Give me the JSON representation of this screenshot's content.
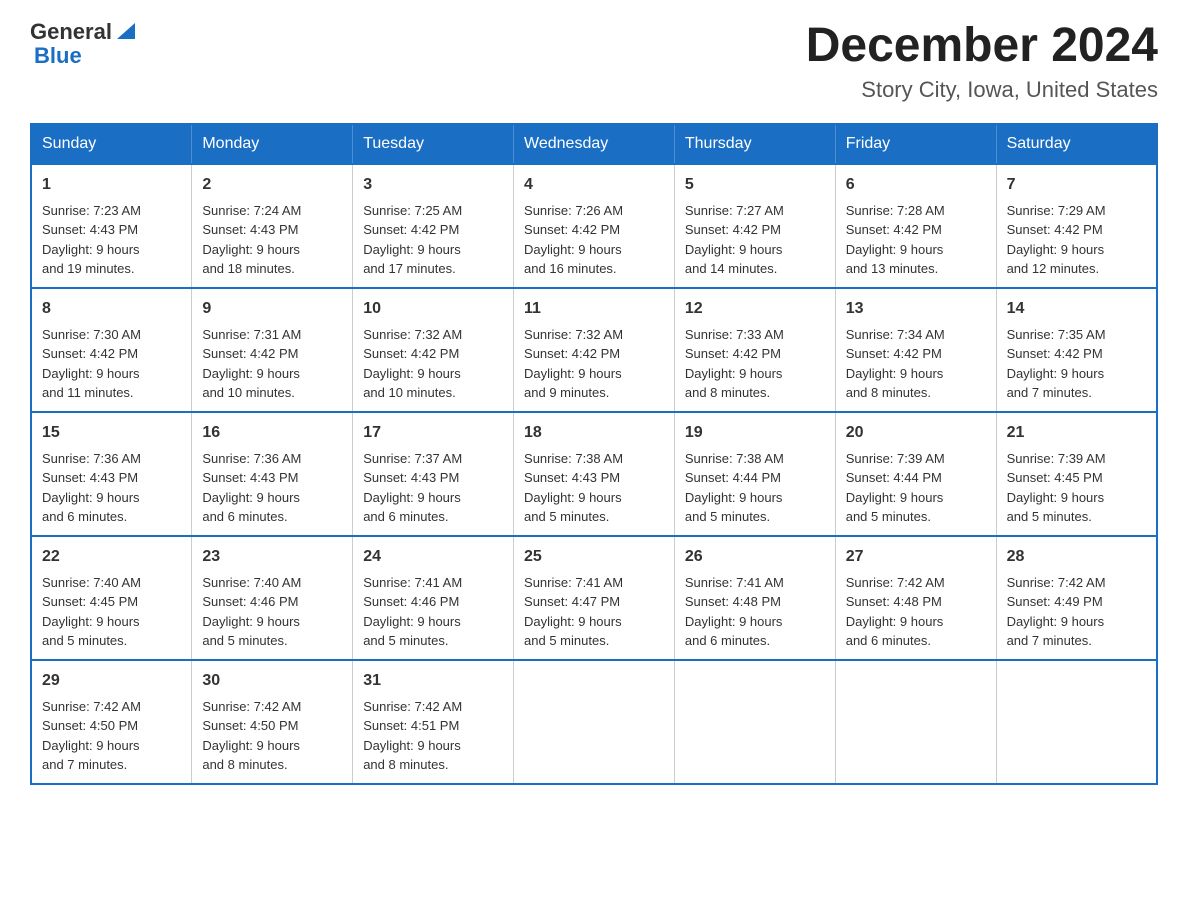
{
  "header": {
    "logo": {
      "general": "General",
      "blue": "Blue"
    },
    "title": "December 2024",
    "location": "Story City, Iowa, United States"
  },
  "days_of_week": [
    "Sunday",
    "Monday",
    "Tuesday",
    "Wednesday",
    "Thursday",
    "Friday",
    "Saturday"
  ],
  "weeks": [
    [
      {
        "day": "1",
        "sunrise": "7:23 AM",
        "sunset": "4:43 PM",
        "daylight": "9 hours and 19 minutes."
      },
      {
        "day": "2",
        "sunrise": "7:24 AM",
        "sunset": "4:43 PM",
        "daylight": "9 hours and 18 minutes."
      },
      {
        "day": "3",
        "sunrise": "7:25 AM",
        "sunset": "4:42 PM",
        "daylight": "9 hours and 17 minutes."
      },
      {
        "day": "4",
        "sunrise": "7:26 AM",
        "sunset": "4:42 PM",
        "daylight": "9 hours and 16 minutes."
      },
      {
        "day": "5",
        "sunrise": "7:27 AM",
        "sunset": "4:42 PM",
        "daylight": "9 hours and 14 minutes."
      },
      {
        "day": "6",
        "sunrise": "7:28 AM",
        "sunset": "4:42 PM",
        "daylight": "9 hours and 13 minutes."
      },
      {
        "day": "7",
        "sunrise": "7:29 AM",
        "sunset": "4:42 PM",
        "daylight": "9 hours and 12 minutes."
      }
    ],
    [
      {
        "day": "8",
        "sunrise": "7:30 AM",
        "sunset": "4:42 PM",
        "daylight": "9 hours and 11 minutes."
      },
      {
        "day": "9",
        "sunrise": "7:31 AM",
        "sunset": "4:42 PM",
        "daylight": "9 hours and 10 minutes."
      },
      {
        "day": "10",
        "sunrise": "7:32 AM",
        "sunset": "4:42 PM",
        "daylight": "9 hours and 10 minutes."
      },
      {
        "day": "11",
        "sunrise": "7:32 AM",
        "sunset": "4:42 PM",
        "daylight": "9 hours and 9 minutes."
      },
      {
        "day": "12",
        "sunrise": "7:33 AM",
        "sunset": "4:42 PM",
        "daylight": "9 hours and 8 minutes."
      },
      {
        "day": "13",
        "sunrise": "7:34 AM",
        "sunset": "4:42 PM",
        "daylight": "9 hours and 8 minutes."
      },
      {
        "day": "14",
        "sunrise": "7:35 AM",
        "sunset": "4:42 PM",
        "daylight": "9 hours and 7 minutes."
      }
    ],
    [
      {
        "day": "15",
        "sunrise": "7:36 AM",
        "sunset": "4:43 PM",
        "daylight": "9 hours and 6 minutes."
      },
      {
        "day": "16",
        "sunrise": "7:36 AM",
        "sunset": "4:43 PM",
        "daylight": "9 hours and 6 minutes."
      },
      {
        "day": "17",
        "sunrise": "7:37 AM",
        "sunset": "4:43 PM",
        "daylight": "9 hours and 6 minutes."
      },
      {
        "day": "18",
        "sunrise": "7:38 AM",
        "sunset": "4:43 PM",
        "daylight": "9 hours and 5 minutes."
      },
      {
        "day": "19",
        "sunrise": "7:38 AM",
        "sunset": "4:44 PM",
        "daylight": "9 hours and 5 minutes."
      },
      {
        "day": "20",
        "sunrise": "7:39 AM",
        "sunset": "4:44 PM",
        "daylight": "9 hours and 5 minutes."
      },
      {
        "day": "21",
        "sunrise": "7:39 AM",
        "sunset": "4:45 PM",
        "daylight": "9 hours and 5 minutes."
      }
    ],
    [
      {
        "day": "22",
        "sunrise": "7:40 AM",
        "sunset": "4:45 PM",
        "daylight": "9 hours and 5 minutes."
      },
      {
        "day": "23",
        "sunrise": "7:40 AM",
        "sunset": "4:46 PM",
        "daylight": "9 hours and 5 minutes."
      },
      {
        "day": "24",
        "sunrise": "7:41 AM",
        "sunset": "4:46 PM",
        "daylight": "9 hours and 5 minutes."
      },
      {
        "day": "25",
        "sunrise": "7:41 AM",
        "sunset": "4:47 PM",
        "daylight": "9 hours and 5 minutes."
      },
      {
        "day": "26",
        "sunrise": "7:41 AM",
        "sunset": "4:48 PM",
        "daylight": "9 hours and 6 minutes."
      },
      {
        "day": "27",
        "sunrise": "7:42 AM",
        "sunset": "4:48 PM",
        "daylight": "9 hours and 6 minutes."
      },
      {
        "day": "28",
        "sunrise": "7:42 AM",
        "sunset": "4:49 PM",
        "daylight": "9 hours and 7 minutes."
      }
    ],
    [
      {
        "day": "29",
        "sunrise": "7:42 AM",
        "sunset": "4:50 PM",
        "daylight": "9 hours and 7 minutes."
      },
      {
        "day": "30",
        "sunrise": "7:42 AM",
        "sunset": "4:50 PM",
        "daylight": "9 hours and 8 minutes."
      },
      {
        "day": "31",
        "sunrise": "7:42 AM",
        "sunset": "4:51 PM",
        "daylight": "9 hours and 8 minutes."
      },
      null,
      null,
      null,
      null
    ]
  ],
  "labels": {
    "sunrise": "Sunrise:",
    "sunset": "Sunset:",
    "daylight": "Daylight:"
  }
}
